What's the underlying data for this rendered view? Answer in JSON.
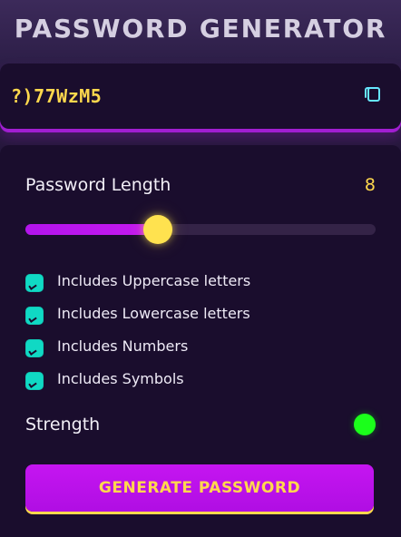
{
  "app": {
    "title": "PASSWORD GENERATOR"
  },
  "output": {
    "password": "?)77WzM5",
    "copy_icon": "copy-icon"
  },
  "settings": {
    "length_label": "Password Length",
    "length_value": "8",
    "slider_fraction": 0.378,
    "options": [
      {
        "label": "Includes Uppercase letters",
        "checked": true
      },
      {
        "label": "Includes Lowercase letters",
        "checked": true
      },
      {
        "label": "Includes Numbers",
        "checked": true
      },
      {
        "label": "Includes Symbols",
        "checked": true
      }
    ],
    "strength_label": "Strength",
    "strength_color": "#1bff1b",
    "generate_label": "GENERATE PASSWORD"
  },
  "theme": {
    "accent_purple": "#c515f1",
    "accent_yellow": "#ffd84d",
    "checkbox_teal": "#10d9c4",
    "card_bg": "#1a0d2d"
  }
}
